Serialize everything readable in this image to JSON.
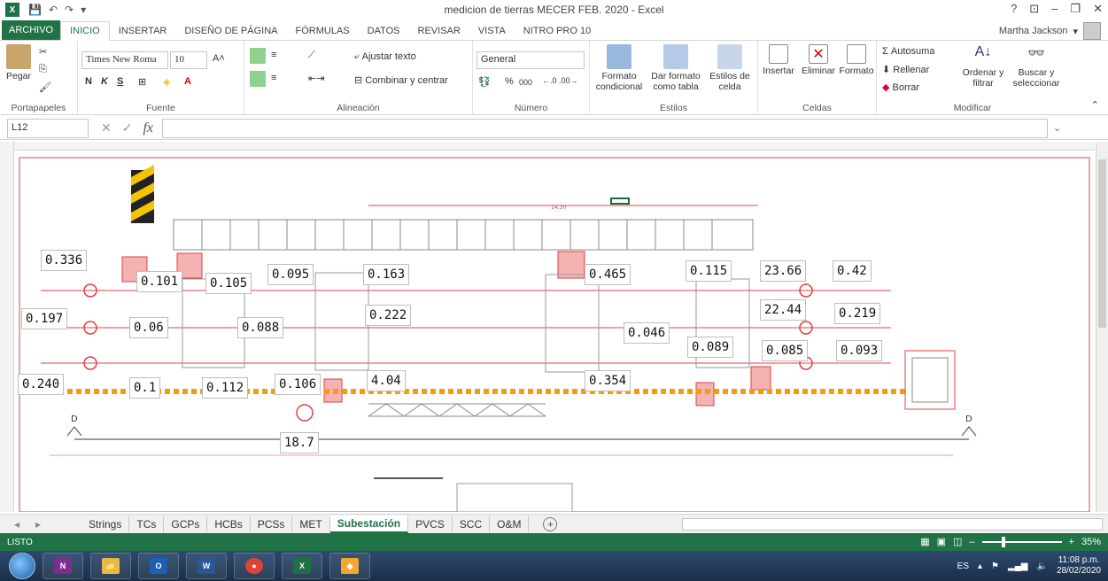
{
  "window": {
    "title": "medicion de tierras MECER FEB. 2020 - Excel",
    "user": "Martha Jackson",
    "help": "?",
    "min": "–",
    "restore": "❐",
    "close": "✕"
  },
  "qat": {
    "save": "💾",
    "undo": "↶",
    "redo": "↷",
    "more": "▾"
  },
  "ribbon_tabs": [
    "ARCHIVO",
    "INICIO",
    "INSERTAR",
    "DISEÑO DE PÁGINA",
    "FÓRMULAS",
    "DATOS",
    "REVISAR",
    "VISTA",
    "NITRO PRO 10"
  ],
  "ribbon": {
    "clipboard": {
      "label": "Portapapeles",
      "paste": "Pegar"
    },
    "font": {
      "label": "Fuente",
      "name": "Times New Roma",
      "size": "10",
      "bold": "N",
      "italic": "K",
      "underline": "S"
    },
    "alignment": {
      "label": "Alineación",
      "wrap": "Ajustar texto",
      "merge": "Combinar y centrar"
    },
    "number": {
      "label": "Número",
      "format": "General",
      "percent": "%",
      "thousands": "000"
    },
    "styles": {
      "label": "Estilos",
      "conditional": "Formato condicional",
      "table": "Dar formato como tabla",
      "cell": "Estilos de celda"
    },
    "cells": {
      "label": "Celdas",
      "insert": "Insertar",
      "delete": "Eliminar",
      "format": "Formato"
    },
    "editing": {
      "label": "Modificar",
      "autosum": "Autosuma",
      "fill": "Rellenar",
      "clear": "Borrar",
      "sort": "Ordenar y filtrar",
      "find": "Buscar y seleccionar"
    }
  },
  "formula_bar": {
    "namebox": "L12",
    "fx": "fx",
    "value": ""
  },
  "measurements": [
    "0.336",
    "0.101",
    "0.105",
    "0.095",
    "0.163",
    "0.465",
    "0.115",
    "23.66",
    "0.42",
    "0.197",
    "0.06",
    "0.088",
    "0.222",
    "0.046",
    "22.44",
    "0.219",
    "0.089",
    "0.085",
    "0.093",
    "0.240",
    "0.1",
    "0.112",
    "0.106",
    "4.04",
    "0.354",
    "18.7"
  ],
  "drawing_text": {
    "section_left": "D",
    "section_right": "D",
    "dim": "14.30"
  },
  "sheet_tabs": [
    "Strings",
    "TCs",
    "GCPs",
    "HCBs",
    "PCSs",
    "MET",
    "Subestación",
    "PVCS",
    "SCC",
    "O&M"
  ],
  "active_sheet": "Subestación",
  "status": {
    "ready": "LISTO",
    "zoom": "35%"
  },
  "taskbar": {
    "lang": "ES",
    "time": "11:08 p.m.",
    "date": "28/02/2020",
    "apps": [
      "N",
      "📁",
      "O",
      "W",
      "●",
      "X",
      "◆"
    ]
  },
  "colors": {
    "excel_green": "#217346",
    "drawing_red": "#e04040",
    "orange": "#f39c12"
  }
}
